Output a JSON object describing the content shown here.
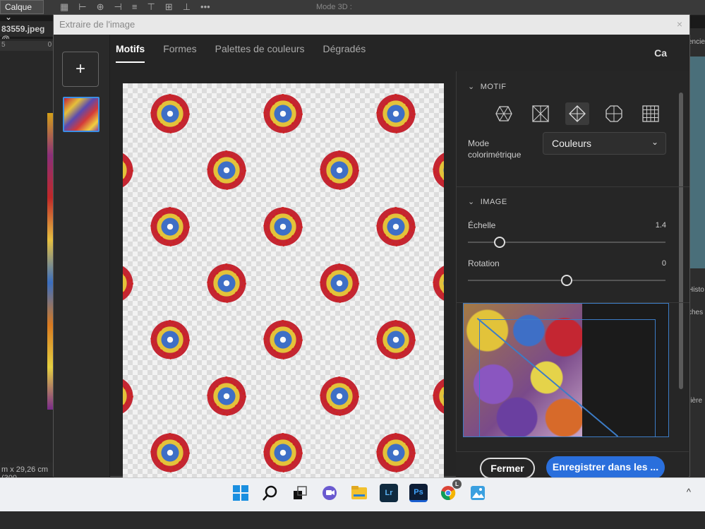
{
  "photoshop": {
    "layer_select": "Calque",
    "mode3d": "Mode 3D :",
    "doc_tab": "83559.jpeg @",
    "ruler_left": "5",
    "ruler_mid": "0",
    "status": "m x 29,26 cm (300",
    "right_labels": [
      "encie",
      "Histo",
      "ches",
      "rière"
    ]
  },
  "dialog": {
    "title": "Extraire de l'image",
    "close_glyph": "×",
    "add_glyph": "+",
    "tabs": [
      "Motifs",
      "Formes",
      "Palettes de couleurs",
      "Dégradés"
    ],
    "badge": "Ca",
    "panel": {
      "motif_header": "MOTIF",
      "mode_label": "Mode colorimétrique",
      "mode_value": "Couleurs",
      "image_header": "IMAGE",
      "scale_label": "Échelle",
      "scale_value": "1.4",
      "scale_fraction": 0.16,
      "rotation_label": "Rotation",
      "rotation_value": "0",
      "rotation_fraction": 0.5
    },
    "buttons": {
      "close": "Fermer",
      "save": "Enregistrer dans les ..."
    }
  },
  "taskbar": {
    "icons": [
      "windows-start-icon",
      "search-icon",
      "task-view-icon",
      "teams-chat-icon",
      "file-explorer-icon",
      "lightroom-icon",
      "photoshop-icon",
      "chrome-icon",
      "photos-icon"
    ],
    "lr_label": "Lr",
    "ps_label": "Ps",
    "chrome_badge": "L",
    "tray": "^"
  }
}
